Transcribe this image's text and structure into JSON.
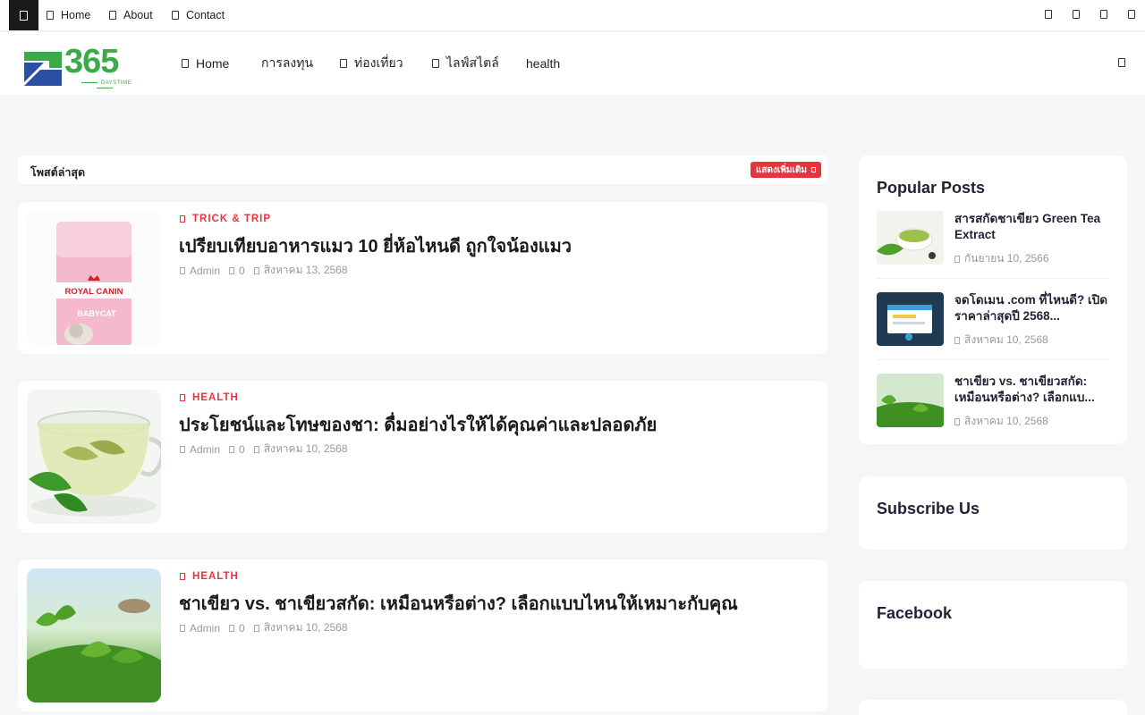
{
  "topbar": {
    "menu_icon": "menu-icon",
    "nav": [
      {
        "label": "Home",
        "icon": "home-icon"
      },
      {
        "label": "About",
        "icon": "info-icon"
      },
      {
        "label": "Contact",
        "icon": "mail-icon"
      }
    ],
    "social_icons": [
      "facebook-icon",
      "twitter-icon",
      "instagram-icon",
      "youtube-icon"
    ]
  },
  "header": {
    "logo_text": "365",
    "logo_sub": "DAYSTIME",
    "brand_color": "#3daa49",
    "nav": [
      {
        "label": "Home",
        "icon": "home-icon"
      },
      {
        "label": "การลงทุน"
      },
      {
        "label": "ท่องเที่ยว",
        "icon": "plane-icon"
      },
      {
        "label": "ไลฟ์สไตล์",
        "icon": "heart-icon"
      },
      {
        "label": "health"
      }
    ],
    "search_icon": "search-icon"
  },
  "latest": {
    "label": "โพสต์ล่าสุด",
    "more_label": "แสดงเพิ่มเติม",
    "accent_color": "#e8343f"
  },
  "posts": [
    {
      "category": "TRICK & TRIP",
      "title": "เปรียบเทียบอาหารแมว 10 ยี่ห้อไหนดี ถูกใจน้องแมว",
      "author": "Admin",
      "comments": "0",
      "date": "สิงหาคม 13, 2568",
      "thumb_brand": "ROYAL CANIN",
      "thumb_product": "BABYCAT"
    },
    {
      "category": "HEALTH",
      "title": "ประโยชน์และโทษของชา: ดื่มอย่างไรให้ได้คุณค่าและปลอดภัย",
      "author": "Admin",
      "comments": "0",
      "date": "สิงหาคม 10, 2568"
    },
    {
      "category": "HEALTH",
      "title": "ชาเขียว vs. ชาเขียวสกัด: เหมือนหรือต่าง? เลือกแบบไหนให้เหมาะกับคุณ",
      "author": "Admin",
      "comments": "0",
      "date": "สิงหาคม 10, 2568"
    }
  ],
  "sidebar": {
    "popular_title": "Popular Posts",
    "popular": [
      {
        "title": "สารสกัดชาเขียว Green Tea Extract",
        "date": "กันยายน 10, 2566"
      },
      {
        "title": "จดโดเมน .com ที่ไหนดี? เปิดราคาล่าสุดปี 2568...",
        "date": "สิงหาคม 10, 2568"
      },
      {
        "title": "ชาเขียว vs. ชาเขียวสกัด: เหมือนหรือต่าง? เลือกแบ...",
        "date": "สิงหาคม 10, 2568"
      }
    ],
    "subscribe_title": "Subscribe Us",
    "facebook_title": "Facebook"
  }
}
